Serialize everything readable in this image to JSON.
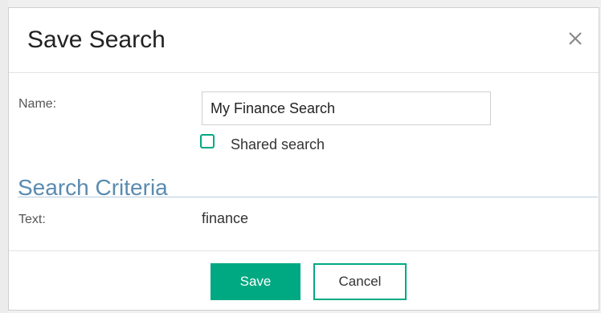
{
  "dialog": {
    "title": "Save Search",
    "close_icon": "close-icon"
  },
  "form": {
    "name_label": "Name:",
    "name_value": "My Finance Search",
    "shared_label": "Shared search",
    "shared_checked": false
  },
  "criteria": {
    "title": "Search Criteria",
    "text_label": "Text:",
    "text_value": "finance"
  },
  "buttons": {
    "save_label": "Save",
    "cancel_label": "Cancel"
  },
  "colors": {
    "accent": "#01a982",
    "section_title": "#5a8bb0"
  }
}
